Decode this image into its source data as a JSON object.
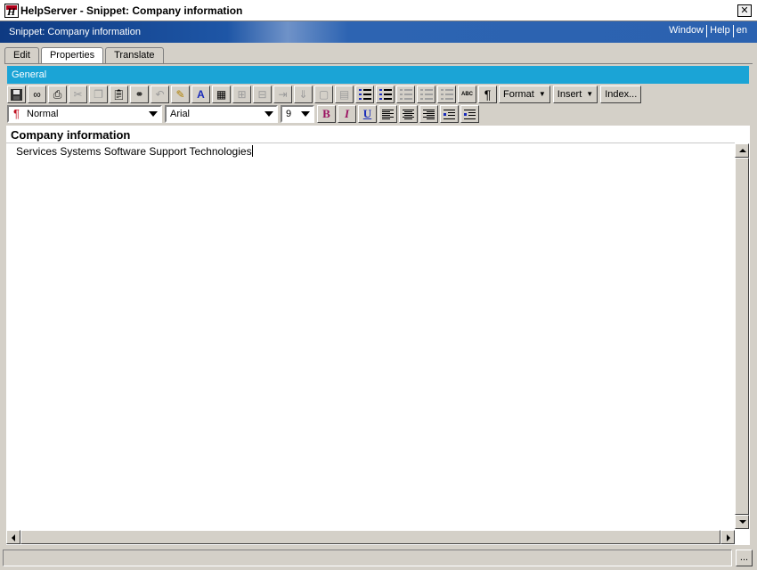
{
  "window": {
    "title": "HelpServer - Snippet: Company information",
    "close_glyph": "✕",
    "app_icon_glyph": "H"
  },
  "header": {
    "snippet_title": "Snippet: Company information",
    "links": [
      "Window",
      "Help",
      "en"
    ]
  },
  "tabs": [
    "Edit",
    "Properties",
    "Translate"
  ],
  "active_tab": "Properties",
  "section_title": "General",
  "toolbar": {
    "format_label": "Format",
    "insert_label": "Insert",
    "index_label": "Index...",
    "paragraph_style": "Normal",
    "font_name": "Arial",
    "font_size": "9",
    "bold_label": "B",
    "italic_label": "I",
    "underline_label": "U",
    "pilcrow": "¶",
    "spell_label": "ABC"
  },
  "editor": {
    "heading": "Company information",
    "content": "Services Systems Software Support Technologies"
  },
  "status": {
    "ellipsis_label": "..."
  },
  "colors": {
    "section_bar": "#1ba4d6",
    "header_bar": "#1e56a6",
    "pilcrow": "#c01020"
  }
}
